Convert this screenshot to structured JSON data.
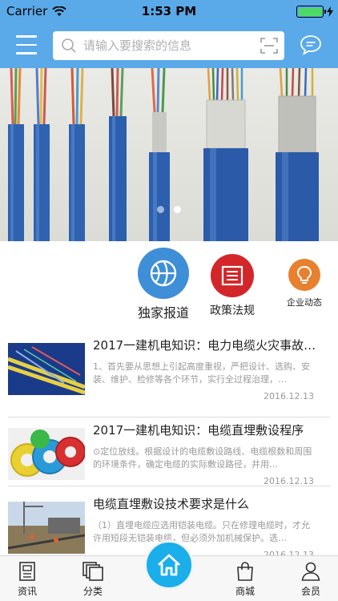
{
  "status_bar": {
    "carrier": "Carrier",
    "time": "1:53 PM"
  },
  "header": {
    "search_placeholder": "请输入要搜索的信息"
  },
  "banner": {
    "total_slides": 2,
    "active_slide": 2
  },
  "categories": [
    {
      "label": "独家报道",
      "icon": "basketball-icon",
      "color": "#3e8ed8"
    },
    {
      "label": "政策法规",
      "icon": "document-list-icon",
      "color": "#d3262a"
    },
    {
      "label": "企业动态",
      "icon": "lightbulb-icon",
      "color": "#e7802f"
    }
  ],
  "news": [
    {
      "title": "2017一建机电知识：电力电缆火灾事故…",
      "summary": "1、首先要从思想上引起高度重视，严把设计、选购、安装、维护、检修等各个环节，实行全过程治理，…",
      "date": "2016.12.13"
    },
    {
      "title": "2017一建机电知识：电缆直埋敷设程序",
      "summary": "⊙定位放线。根据设计的电缆敷设路线、电缆根数和周围的环境条件，确定电缆的实际敷设路径，并用…",
      "date": "2016.12.13"
    },
    {
      "title": "电缆直埋敷设技术要求是什么",
      "summary": "（1）直埋电缆应选用铠装电缆。只在修理电缆时，才允许用短段无铠装电缆，但必须外加机械保护。选…",
      "date": "2016.12.13"
    }
  ],
  "tabbar": [
    {
      "label": "资讯",
      "icon": "news-icon"
    },
    {
      "label": "分类",
      "icon": "category-icon"
    },
    {
      "label": "",
      "icon": "home-icon"
    },
    {
      "label": "商城",
      "icon": "shopping-bag-icon"
    },
    {
      "label": "会员",
      "icon": "user-icon"
    }
  ],
  "colors": {
    "primary": "#5aa9e8",
    "home_button": "#1aaeea"
  }
}
